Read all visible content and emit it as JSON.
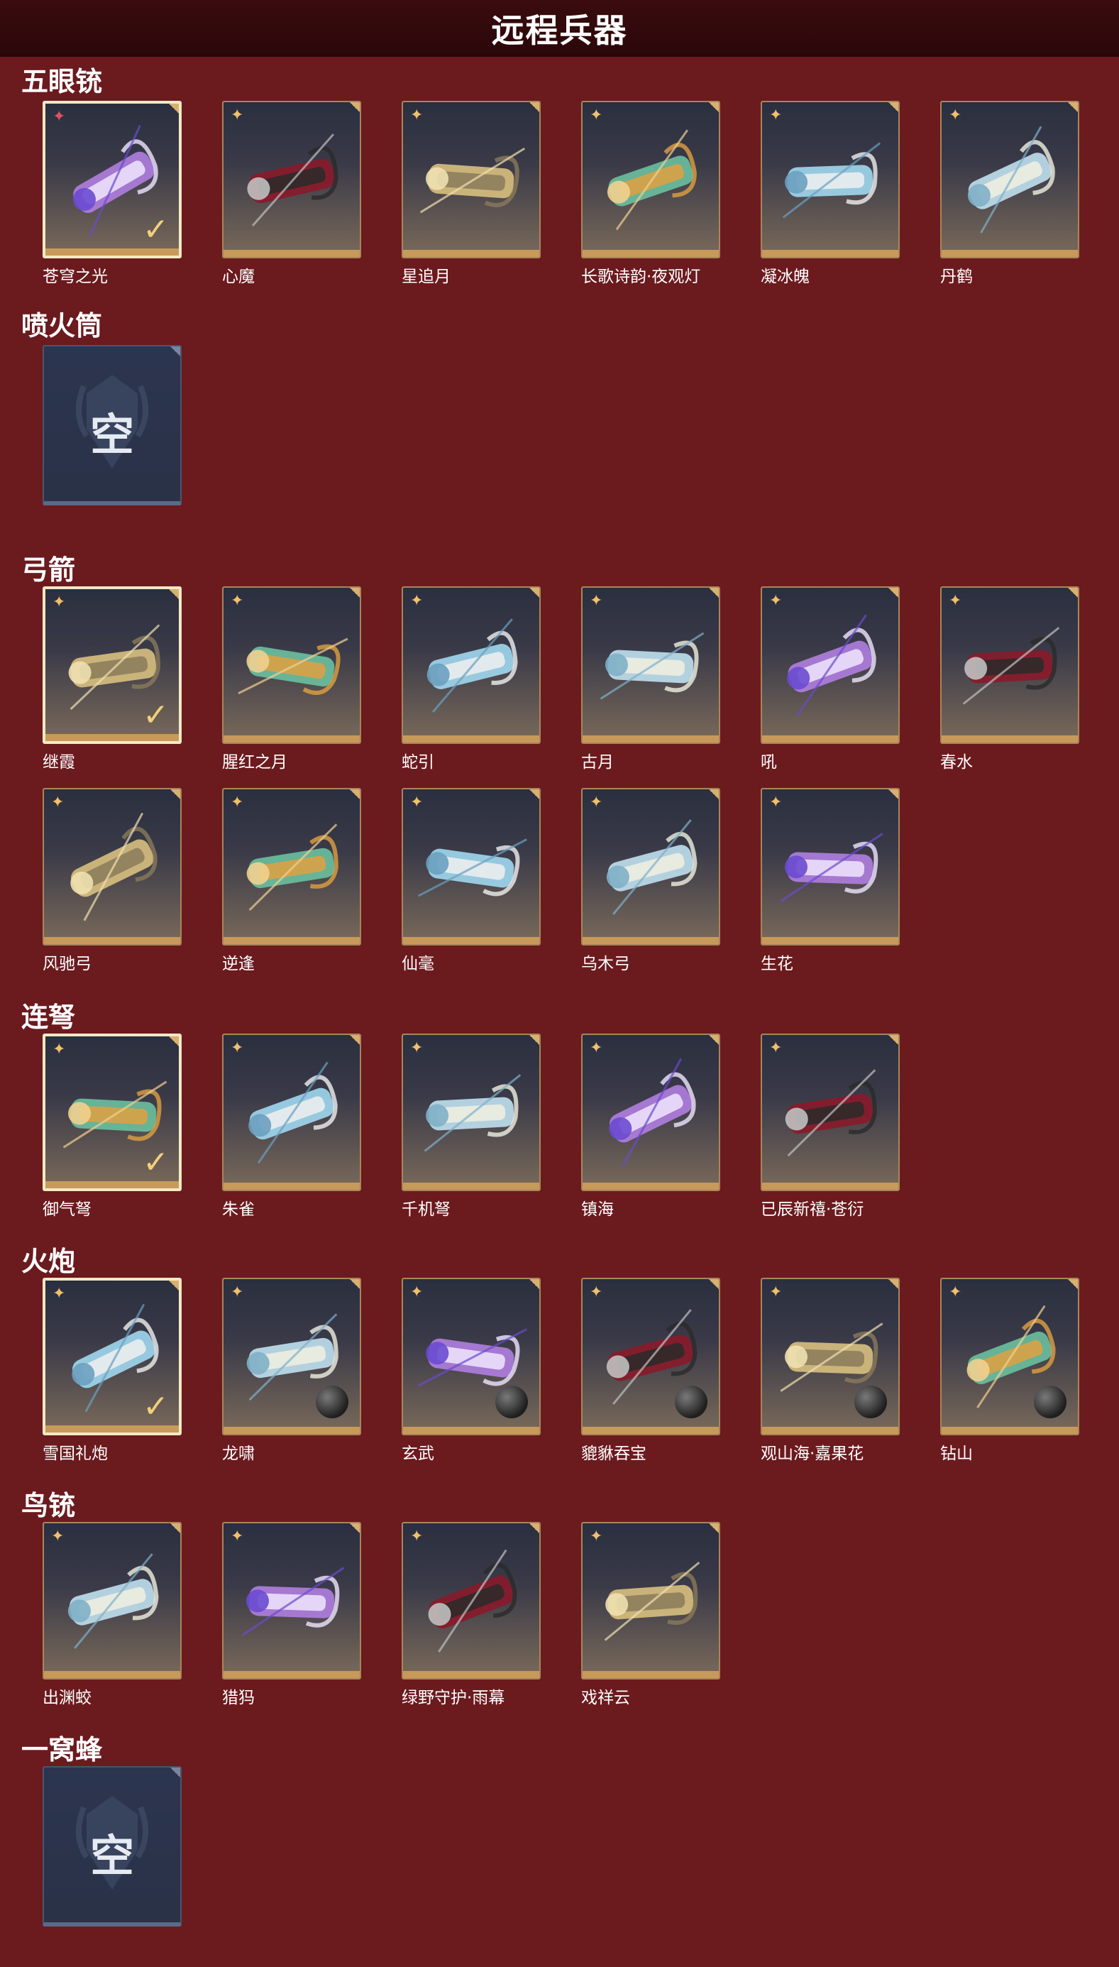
{
  "header": {
    "title": "远程兵器"
  },
  "colors": {
    "background": "#6b1a1e",
    "frame_gold": "#c89a5a",
    "selected_border": "#f5e9c4",
    "star": "#f2c06a"
  },
  "sections": [
    {
      "title": "五眼铳",
      "items": [
        {
          "name": "苍穹之光",
          "selected": true,
          "star": "red-star-icon"
        },
        {
          "name": "心魔"
        },
        {
          "name": "星追月"
        },
        {
          "name": "长歌诗韵·夜观灯"
        },
        {
          "name": "凝冰魄"
        },
        {
          "name": "丹鹤"
        }
      ]
    },
    {
      "title": "喷火筒",
      "empty": "空"
    },
    {
      "title": "弓箭",
      "items": [
        {
          "name": "继霞",
          "selected": true
        },
        {
          "name": "腥红之月"
        },
        {
          "name": "蛇引"
        },
        {
          "name": "古月"
        },
        {
          "name": "吼"
        },
        {
          "name": "春水"
        },
        {
          "name": "风驰弓"
        },
        {
          "name": "逆逢"
        },
        {
          "name": "仙毫"
        },
        {
          "name": "乌木弓"
        },
        {
          "name": "生花"
        }
      ]
    },
    {
      "title": "连弩",
      "items": [
        {
          "name": "御气弩",
          "selected": true
        },
        {
          "name": "朱雀"
        },
        {
          "name": "千机弩"
        },
        {
          "name": "镇海"
        },
        {
          "name": "已辰新禧·苍衍"
        }
      ]
    },
    {
      "title": "火炮",
      "items": [
        {
          "name": "雪国礼炮",
          "selected": true
        },
        {
          "name": "龙啸"
        },
        {
          "name": "玄武"
        },
        {
          "name": "貔貅吞宝"
        },
        {
          "name": "观山海·嘉果花"
        },
        {
          "name": "钻山"
        }
      ]
    },
    {
      "title": "鸟铳",
      "items": [
        {
          "name": "出渊蛟"
        },
        {
          "name": "猎犸"
        },
        {
          "name": "绿野守护·雨幕"
        },
        {
          "name": "戏祥云"
        }
      ]
    },
    {
      "title": "一窝蜂",
      "empty": "空"
    }
  ]
}
